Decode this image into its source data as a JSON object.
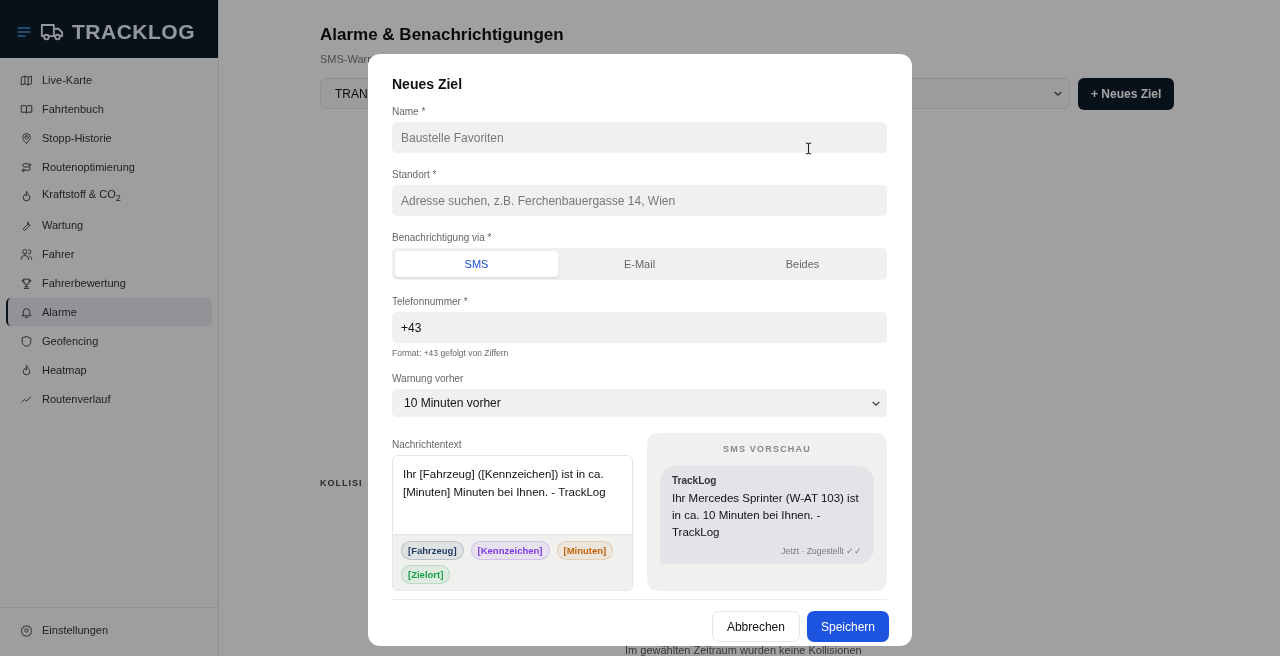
{
  "app": {
    "logo": "TRACKLOG"
  },
  "sidebar": {
    "items": [
      {
        "label": "Live-Karte",
        "selected": false
      },
      {
        "label": "Fahrtenbuch",
        "selected": false
      },
      {
        "label": "Stopp-Historie",
        "selected": false
      },
      {
        "label": "Routenoptimierung",
        "selected": false
      },
      {
        "label": "Kraftstoff & CO$_{2}$",
        "selected": false
      },
      {
        "label": "Wartung",
        "selected": false
      },
      {
        "label": "Fahrer",
        "selected": false
      },
      {
        "label": "Fahrerbewertung",
        "selected": false
      },
      {
        "label": "Alarme",
        "selected": true
      },
      {
        "label": "Geofencing",
        "selected": false
      },
      {
        "label": "Heatmap",
        "selected": false
      },
      {
        "label": "Routenverlauf",
        "selected": false
      }
    ],
    "footer": {
      "label": "Einstellungen"
    }
  },
  "page": {
    "title": "Alarme & Benachrichtigungen",
    "subtitle": "SMS-Warn",
    "filter": {
      "value": "TRAN"
    },
    "new_button": "+ Neues Ziel",
    "section_heading": "KOLLISI",
    "empty_text": "Im gewählten Zeitraum wurden keine Kollisionen"
  },
  "dialog": {
    "title": "Neues Ziel",
    "name": {
      "label": "Name *",
      "placeholder": "Baustelle Favoriten"
    },
    "location": {
      "label": "Standort *",
      "placeholder": "Adresse suchen, z.B. Ferchenbauergasse 14, Wien"
    },
    "channel": {
      "label": "Benachrichtigung via *",
      "options": [
        {
          "label": "SMS",
          "selected": true
        },
        {
          "label": "E-Mail",
          "selected": false
        },
        {
          "label": "Beides",
          "selected": false
        }
      ]
    },
    "phone": {
      "label": "Telefonnummer *",
      "value": "+43",
      "hint": "Format: +43 gefolgt von Ziffern"
    },
    "warning": {
      "label": "Warnung vorher",
      "value": "10 Minuten vorher"
    },
    "message": {
      "label": "Nachrichtentext",
      "value": "Ihr [Fahrzeug] ([Kennzeichen]) ist in ca. [Minuten] Minuten bei Ihnen. - TrackLog",
      "tags": [
        {
          "label": "[Fahrzeug]",
          "color": "#1e3a5f"
        },
        {
          "label": "[Kennzeichen]",
          "color": "#7c3aed"
        },
        {
          "label": "[Minuten]",
          "color": "#c2620a"
        },
        {
          "label": "[Zielort]",
          "color": "#16a34a"
        }
      ]
    },
    "preview": {
      "heading": "SMS VORSCHAU",
      "sender": "TrackLog",
      "text": "Ihr Mercedes Sprinter (W-AT 103) ist in ca. 10 Minuten bei Ihnen. - TrackLog",
      "status": "Jetzt · Zugestellt ✓✓"
    },
    "buttons": {
      "cancel": "Abbrechen",
      "save": "Speichern"
    }
  }
}
